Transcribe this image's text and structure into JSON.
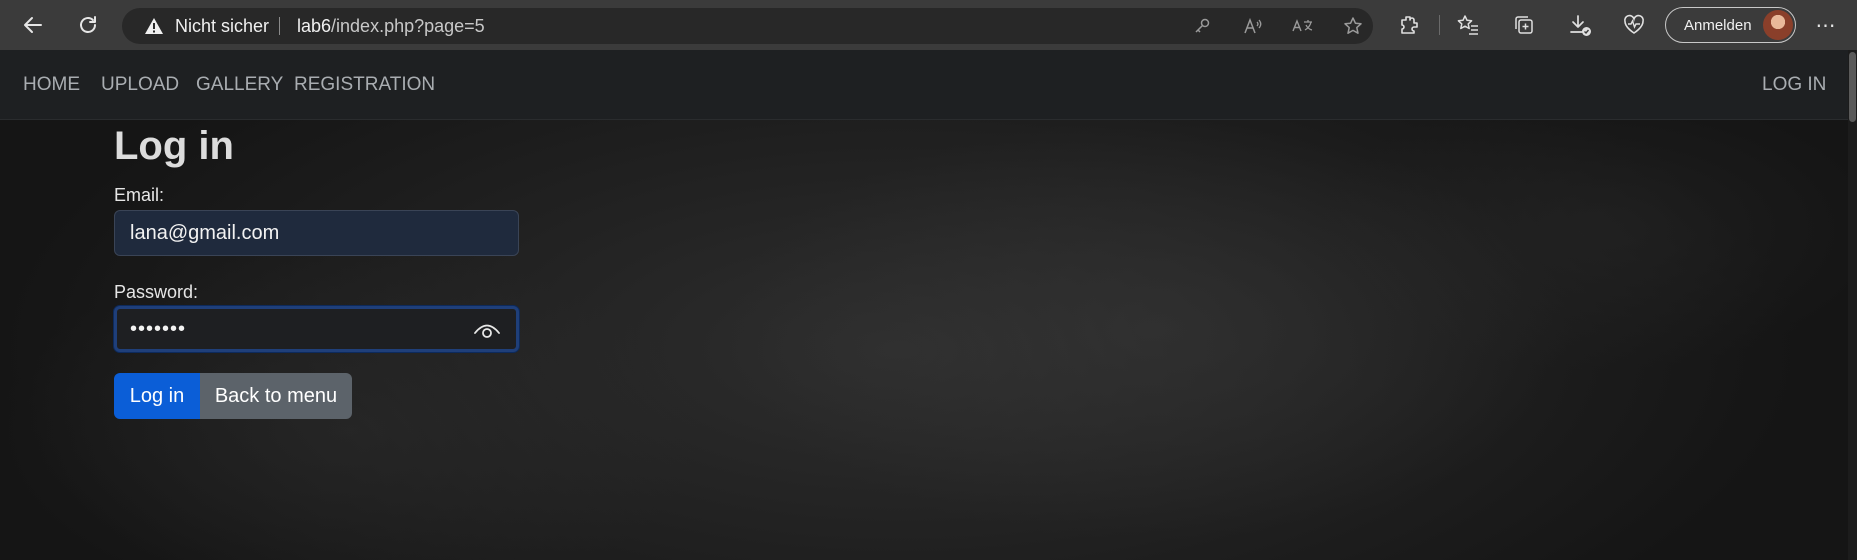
{
  "browser": {
    "not_secure_label": "Nicht sicher",
    "url_host": "lab6",
    "url_path": "/index.php?page=5",
    "signin_label": "Anmelden"
  },
  "navbar": {
    "items": [
      {
        "label": "HOME"
      },
      {
        "label": "UPLOAD"
      },
      {
        "label": "GALLERY"
      },
      {
        "label": "REGISTRATION"
      }
    ],
    "login_label": "LOG IN"
  },
  "form": {
    "title": "Log in",
    "email_label": "Email:",
    "email_value": "lana@gmail.com",
    "password_label": "Password:",
    "password_value": "•••••••",
    "login_button": "Log in",
    "back_button": "Back to menu"
  },
  "colors": {
    "primary": "#0b5ed7",
    "secondary": "#5c636a",
    "navbar_bg": "#1e2022"
  }
}
